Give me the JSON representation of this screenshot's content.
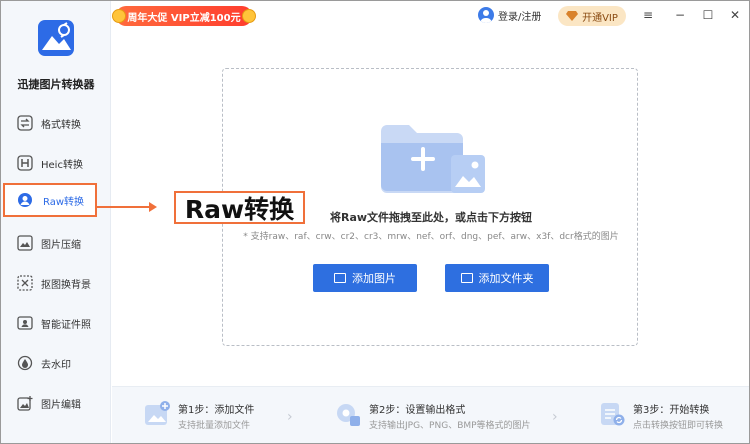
{
  "app": {
    "name": "迅捷图片转换器"
  },
  "titlebar": {
    "promo": "周年大促 VIP立减100元",
    "login": "登录/注册",
    "vip": "开通VIP",
    "menu_icon": "≡",
    "minimize_icon": "−",
    "maximize_icon": "☐",
    "close_icon": "✕"
  },
  "sidebar": {
    "items": [
      {
        "label": "格式转换",
        "icon": "format-convert-icon"
      },
      {
        "label": "Heic转换",
        "icon": "heic-icon"
      },
      {
        "label": "Raw转换",
        "icon": "raw-icon",
        "active": true
      },
      {
        "label": "图片压缩",
        "icon": "compress-icon"
      },
      {
        "label": "抠图换背景",
        "icon": "cutout-icon"
      },
      {
        "label": "智能证件照",
        "icon": "id-photo-icon"
      },
      {
        "label": "去水印",
        "icon": "watermark-icon"
      },
      {
        "label": "图片编辑",
        "icon": "edit-icon"
      }
    ]
  },
  "dropzone": {
    "title": "将Raw文件拖拽至此处，或点击下方按钮",
    "subtitle": "* 支持raw、raf、crw、cr2、cr3、mrw、nef、orf、dng、pef、arw、x3f、dcr格式的图片",
    "add_image": "添加图片",
    "add_folder": "添加文件夹"
  },
  "annotation": {
    "label": "Raw转换"
  },
  "steps": [
    {
      "title": "第1步：添加文件",
      "desc": "支持批量添加文件"
    },
    {
      "title": "第2步：设置输出格式",
      "desc": "支持输出JPG、PNG、BMP等格式的图片"
    },
    {
      "title": "第3步：开始转换",
      "desc": "点击转换按钮即可转换"
    }
  ],
  "colors": {
    "accent": "#2e6fe0",
    "highlight": "#f0703a",
    "promo": "#ff4a2e"
  }
}
